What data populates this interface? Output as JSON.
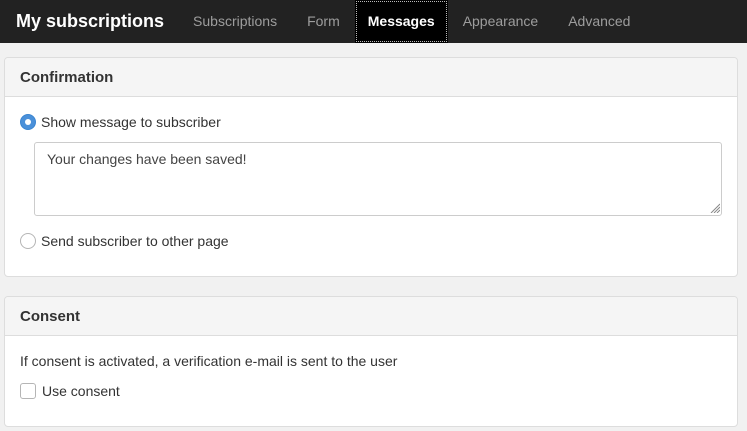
{
  "navbar": {
    "brand": "My subscriptions",
    "tabs": [
      {
        "label": "Subscriptions",
        "active": false
      },
      {
        "label": "Form",
        "active": false
      },
      {
        "label": "Messages",
        "active": true
      },
      {
        "label": "Appearance",
        "active": false
      },
      {
        "label": "Advanced",
        "active": false
      }
    ]
  },
  "confirmation": {
    "heading": "Confirmation",
    "option_show_message": "Show message to subscriber",
    "message_value": "Your changes have been saved!",
    "option_send_page": "Send subscriber to other page",
    "selected": "show_message"
  },
  "consent": {
    "heading": "Consent",
    "description": "If consent is activated, a verification e-mail is sent to the user",
    "checkbox_label": "Use consent",
    "checked": false
  },
  "colors": {
    "navbar_bg": "#222222",
    "active_tab_bg": "#000000",
    "radio_accent": "#4a90d9"
  }
}
